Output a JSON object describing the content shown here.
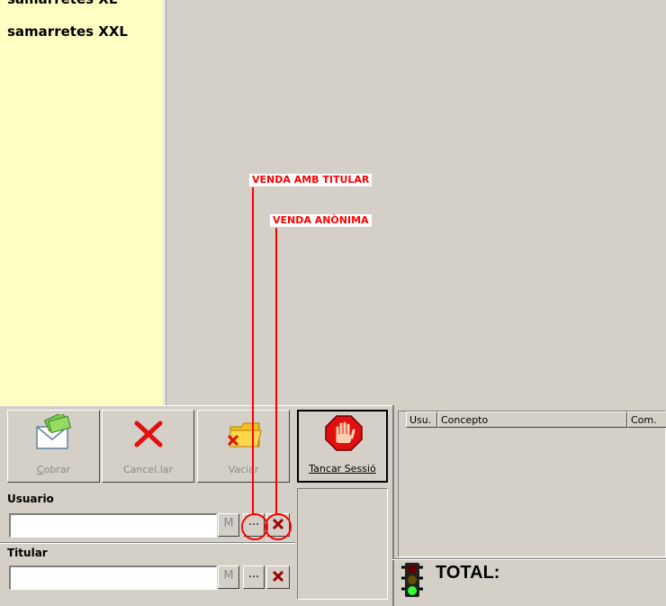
{
  "products": {
    "items": [
      {
        "label": "samarretes XL"
      },
      {
        "label": "samarretes XXL"
      }
    ]
  },
  "annotations": {
    "amb_titular": "VENDA AMB TITULAR",
    "anonima": "VENDA ANÒNIMA"
  },
  "toolbar": {
    "cobrar_label": "Cobrar",
    "cancellar_label": "Cancel.lar",
    "vaciar_label": "Vaciar",
    "tancar_label": "Tancar Sessió"
  },
  "usuario": {
    "label": "Usuario",
    "value": "",
    "m_label": "M",
    "dots_label": "..."
  },
  "titular": {
    "label": "Titular",
    "value": "",
    "m_label": "M",
    "dots_label": "..."
  },
  "grid": {
    "columns": [
      "Usu.",
      "Concepto",
      "Com."
    ]
  },
  "total": {
    "label": "TOTAL:"
  },
  "colors": {
    "panel": "#d4d0c8",
    "list_background": "#ffffc4",
    "annotation": "#ff0000"
  },
  "icons": [
    "money-envelope-icon",
    "red-x-icon",
    "folder-x-icon",
    "stop-hand-icon",
    "delete-x-icon",
    "traffic-light-icon"
  ]
}
